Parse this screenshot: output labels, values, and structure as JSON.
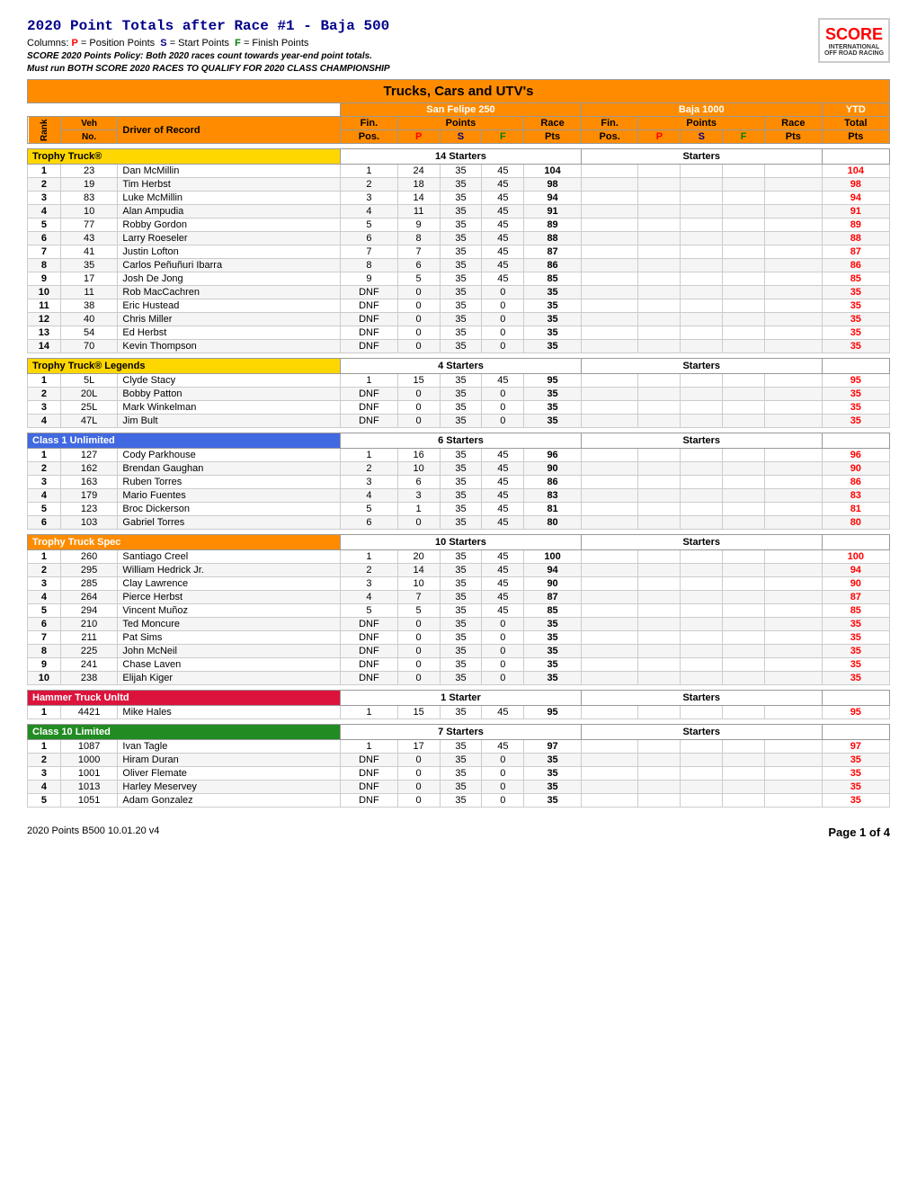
{
  "page": {
    "title": "2020 Point Totals after Race #1 - Baja 500",
    "subtitle": "Columns: P = Position Points  S = Start Points  F = Finish Points",
    "policy1": "SCORE 2020 Points Policy: Both 2020 races count towards year-end point totals.",
    "policy2": "Must run BOTH SCORE 2020 RACES TO QUALIFY FOR 2020 CLASS CHAMPIONSHIP",
    "main_section": "Trucks, Cars and UTV's",
    "sf_label": "San Felipe 250",
    "baja_label": "Baja 1000",
    "ytd_label": "YTD",
    "col_fin": "Fin.",
    "col_points": "Points",
    "col_race": "Race",
    "col_pos": "Pos.",
    "col_p": "P",
    "col_s": "S",
    "col_f": "F",
    "col_pts": "Pts",
    "col_total": "Total",
    "col_rank": "Rank",
    "col_veh": "Veh",
    "col_veh_no": "No.",
    "col_driver": "Driver of Record"
  },
  "classes": [
    {
      "name": "Trophy Truck®",
      "color": "yellow",
      "starters": "14 Starters",
      "baja_starters": "Starters",
      "drivers": [
        {
          "rank": "1",
          "veh": "23",
          "driver": "Dan McMillin",
          "fin": "1",
          "p": "24",
          "s": "35",
          "f": "45",
          "pts": "104",
          "bfin": "",
          "bp": "",
          "bs": "",
          "bf": "",
          "bpts": "",
          "ytd": "104"
        },
        {
          "rank": "2",
          "veh": "19",
          "driver": "Tim Herbst",
          "fin": "2",
          "p": "18",
          "s": "35",
          "f": "45",
          "pts": "98",
          "bfin": "",
          "bp": "",
          "bs": "",
          "bf": "",
          "bpts": "",
          "ytd": "98"
        },
        {
          "rank": "3",
          "veh": "83",
          "driver": "Luke McMillin",
          "fin": "3",
          "p": "14",
          "s": "35",
          "f": "45",
          "pts": "94",
          "bfin": "",
          "bp": "",
          "bs": "",
          "bf": "",
          "bpts": "",
          "ytd": "94"
        },
        {
          "rank": "4",
          "veh": "10",
          "driver": "Alan Ampudia",
          "fin": "4",
          "p": "11",
          "s": "35",
          "f": "45",
          "pts": "91",
          "bfin": "",
          "bp": "",
          "bs": "",
          "bf": "",
          "bpts": "",
          "ytd": "91"
        },
        {
          "rank": "5",
          "veh": "77",
          "driver": "Robby Gordon",
          "fin": "5",
          "p": "9",
          "s": "35",
          "f": "45",
          "pts": "89",
          "bfin": "",
          "bp": "",
          "bs": "",
          "bf": "",
          "bpts": "",
          "ytd": "89"
        },
        {
          "rank": "6",
          "veh": "43",
          "driver": "Larry Roeseler",
          "fin": "6",
          "p": "8",
          "s": "35",
          "f": "45",
          "pts": "88",
          "bfin": "",
          "bp": "",
          "bs": "",
          "bf": "",
          "bpts": "",
          "ytd": "88"
        },
        {
          "rank": "7",
          "veh": "41",
          "driver": "Justin Lofton",
          "fin": "7",
          "p": "7",
          "s": "35",
          "f": "45",
          "pts": "87",
          "bfin": "",
          "bp": "",
          "bs": "",
          "bf": "",
          "bpts": "",
          "ytd": "87"
        },
        {
          "rank": "8",
          "veh": "35",
          "driver": "Carlos Peñuñuri Ibarra",
          "fin": "8",
          "p": "6",
          "s": "35",
          "f": "45",
          "pts": "86",
          "bfin": "",
          "bp": "",
          "bs": "",
          "bf": "",
          "bpts": "",
          "ytd": "86"
        },
        {
          "rank": "9",
          "veh": "17",
          "driver": "Josh De Jong",
          "fin": "9",
          "p": "5",
          "s": "35",
          "f": "45",
          "pts": "85",
          "bfin": "",
          "bp": "",
          "bs": "",
          "bf": "",
          "bpts": "",
          "ytd": "85"
        },
        {
          "rank": "10",
          "veh": "11",
          "driver": "Rob MacCachren",
          "fin": "DNF",
          "p": "0",
          "s": "35",
          "f": "0",
          "pts": "35",
          "bfin": "",
          "bp": "",
          "bs": "",
          "bf": "",
          "bpts": "",
          "ytd": "35"
        },
        {
          "rank": "11",
          "veh": "38",
          "driver": "Eric Hustead",
          "fin": "DNF",
          "p": "0",
          "s": "35",
          "f": "0",
          "pts": "35",
          "bfin": "",
          "bp": "",
          "bs": "",
          "bf": "",
          "bpts": "",
          "ytd": "35"
        },
        {
          "rank": "12",
          "veh": "40",
          "driver": "Chris Miller",
          "fin": "DNF",
          "p": "0",
          "s": "35",
          "f": "0",
          "pts": "35",
          "bfin": "",
          "bp": "",
          "bs": "",
          "bf": "",
          "bpts": "",
          "ytd": "35"
        },
        {
          "rank": "13",
          "veh": "54",
          "driver": "Ed Herbst",
          "fin": "DNF",
          "p": "0",
          "s": "35",
          "f": "0",
          "pts": "35",
          "bfin": "",
          "bp": "",
          "bs": "",
          "bf": "",
          "bpts": "",
          "ytd": "35"
        },
        {
          "rank": "14",
          "veh": "70",
          "driver": "Kevin Thompson",
          "fin": "DNF",
          "p": "0",
          "s": "35",
          "f": "0",
          "pts": "35",
          "bfin": "",
          "bp": "",
          "bs": "",
          "bf": "",
          "bpts": "",
          "ytd": "35"
        }
      ]
    },
    {
      "name": "Trophy Truck® Legends",
      "color": "yellow",
      "starters": "4 Starters",
      "baja_starters": "Starters",
      "drivers": [
        {
          "rank": "1",
          "veh": "5L",
          "driver": "Clyde Stacy",
          "fin": "1",
          "p": "15",
          "s": "35",
          "f": "45",
          "pts": "95",
          "bfin": "",
          "bp": "",
          "bs": "",
          "bf": "",
          "bpts": "",
          "ytd": "95"
        },
        {
          "rank": "2",
          "veh": "20L",
          "driver": "Bobby Patton",
          "fin": "DNF",
          "p": "0",
          "s": "35",
          "f": "0",
          "pts": "35",
          "bfin": "",
          "bp": "",
          "bs": "",
          "bf": "",
          "bpts": "",
          "ytd": "35"
        },
        {
          "rank": "3",
          "veh": "25L",
          "driver": "Mark Winkelman",
          "fin": "DNF",
          "p": "0",
          "s": "35",
          "f": "0",
          "pts": "35",
          "bfin": "",
          "bp": "",
          "bs": "",
          "bf": "",
          "bpts": "",
          "ytd": "35"
        },
        {
          "rank": "4",
          "veh": "47L",
          "driver": "Jim Bult",
          "fin": "DNF",
          "p": "0",
          "s": "35",
          "f": "0",
          "pts": "35",
          "bfin": "",
          "bp": "",
          "bs": "",
          "bf": "",
          "bpts": "",
          "ytd": "35"
        }
      ]
    },
    {
      "name": "Class 1 Unlimited",
      "color": "blue",
      "starters": "6 Starters",
      "baja_starters": "Starters",
      "drivers": [
        {
          "rank": "1",
          "veh": "127",
          "driver": "Cody Parkhouse",
          "fin": "1",
          "p": "16",
          "s": "35",
          "f": "45",
          "pts": "96",
          "bfin": "",
          "bp": "",
          "bs": "",
          "bf": "",
          "bpts": "",
          "ytd": "96"
        },
        {
          "rank": "2",
          "veh": "162",
          "driver": "Brendan Gaughan",
          "fin": "2",
          "p": "10",
          "s": "35",
          "f": "45",
          "pts": "90",
          "bfin": "",
          "bp": "",
          "bs": "",
          "bf": "",
          "bpts": "",
          "ytd": "90"
        },
        {
          "rank": "3",
          "veh": "163",
          "driver": "Ruben Torres",
          "fin": "3",
          "p": "6",
          "s": "35",
          "f": "45",
          "pts": "86",
          "bfin": "",
          "bp": "",
          "bs": "",
          "bf": "",
          "bpts": "",
          "ytd": "86"
        },
        {
          "rank": "4",
          "veh": "179",
          "driver": "Mario Fuentes",
          "fin": "4",
          "p": "3",
          "s": "35",
          "f": "45",
          "pts": "83",
          "bfin": "",
          "bp": "",
          "bs": "",
          "bf": "",
          "bpts": "",
          "ytd": "83"
        },
        {
          "rank": "5",
          "veh": "123",
          "driver": "Broc Dickerson",
          "fin": "5",
          "p": "1",
          "s": "35",
          "f": "45",
          "pts": "81",
          "bfin": "",
          "bp": "",
          "bs": "",
          "bf": "",
          "bpts": "",
          "ytd": "81"
        },
        {
          "rank": "6",
          "veh": "103",
          "driver": "Gabriel Torres",
          "fin": "6",
          "p": "0",
          "s": "35",
          "f": "45",
          "pts": "80",
          "bfin": "",
          "bp": "",
          "bs": "",
          "bf": "",
          "bpts": "",
          "ytd": "80"
        }
      ]
    },
    {
      "name": "Trophy Truck Spec",
      "color": "orange",
      "starters": "10 Starters",
      "baja_starters": "Starters",
      "drivers": [
        {
          "rank": "1",
          "veh": "260",
          "driver": "Santiago Creel",
          "fin": "1",
          "p": "20",
          "s": "35",
          "f": "45",
          "pts": "100",
          "bfin": "",
          "bp": "",
          "bs": "",
          "bf": "",
          "bpts": "",
          "ytd": "100"
        },
        {
          "rank": "2",
          "veh": "295",
          "driver": "William Hedrick Jr.",
          "fin": "2",
          "p": "14",
          "s": "35",
          "f": "45",
          "pts": "94",
          "bfin": "",
          "bp": "",
          "bs": "",
          "bf": "",
          "bpts": "",
          "ytd": "94"
        },
        {
          "rank": "3",
          "veh": "285",
          "driver": "Clay Lawrence",
          "fin": "3",
          "p": "10",
          "s": "35",
          "f": "45",
          "pts": "90",
          "bfin": "",
          "bp": "",
          "bs": "",
          "bf": "",
          "bpts": "",
          "ytd": "90"
        },
        {
          "rank": "4",
          "veh": "264",
          "driver": "Pierce Herbst",
          "fin": "4",
          "p": "7",
          "s": "35",
          "f": "45",
          "pts": "87",
          "bfin": "",
          "bp": "",
          "bs": "",
          "bf": "",
          "bpts": "",
          "ytd": "87"
        },
        {
          "rank": "5",
          "veh": "294",
          "driver": "Vincent Muñoz",
          "fin": "5",
          "p": "5",
          "s": "35",
          "f": "45",
          "pts": "85",
          "bfin": "",
          "bp": "",
          "bs": "",
          "bf": "",
          "bpts": "",
          "ytd": "85"
        },
        {
          "rank": "6",
          "veh": "210",
          "driver": "Ted Moncure",
          "fin": "DNF",
          "p": "0",
          "s": "35",
          "f": "0",
          "pts": "35",
          "bfin": "",
          "bp": "",
          "bs": "",
          "bf": "",
          "bpts": "",
          "ytd": "35"
        },
        {
          "rank": "7",
          "veh": "211",
          "driver": "Pat Sims",
          "fin": "DNF",
          "p": "0",
          "s": "35",
          "f": "0",
          "pts": "35",
          "bfin": "",
          "bp": "",
          "bs": "",
          "bf": "",
          "bpts": "",
          "ytd": "35"
        },
        {
          "rank": "8",
          "veh": "225",
          "driver": "John McNeil",
          "fin": "DNF",
          "p": "0",
          "s": "35",
          "f": "0",
          "pts": "35",
          "bfin": "",
          "bp": "",
          "bs": "",
          "bf": "",
          "bpts": "",
          "ytd": "35"
        },
        {
          "rank": "9",
          "veh": "241",
          "driver": "Chase Laven",
          "fin": "DNF",
          "p": "0",
          "s": "35",
          "f": "0",
          "pts": "35",
          "bfin": "",
          "bp": "",
          "bs": "",
          "bf": "",
          "bpts": "",
          "ytd": "35"
        },
        {
          "rank": "10",
          "veh": "238",
          "driver": "Elijah Kiger",
          "fin": "DNF",
          "p": "0",
          "s": "35",
          "f": "0",
          "pts": "35",
          "bfin": "",
          "bp": "",
          "bs": "",
          "bf": "",
          "bpts": "",
          "ytd": "35"
        }
      ]
    },
    {
      "name": "Hammer Truck Unltd",
      "color": "red",
      "starters": "1 Starter",
      "baja_starters": "Starters",
      "drivers": [
        {
          "rank": "1",
          "veh": "4421",
          "driver": "Mike Hales",
          "fin": "1",
          "p": "15",
          "s": "35",
          "f": "45",
          "pts": "95",
          "bfin": "",
          "bp": "",
          "bs": "",
          "bf": "",
          "bpts": "",
          "ytd": "95"
        }
      ]
    },
    {
      "name": "Class 10 Limited",
      "color": "green",
      "starters": "7 Starters",
      "baja_starters": "Starters",
      "drivers": [
        {
          "rank": "1",
          "veh": "1087",
          "driver": "Ivan Tagle",
          "fin": "1",
          "p": "17",
          "s": "35",
          "f": "45",
          "pts": "97",
          "bfin": "",
          "bp": "",
          "bs": "",
          "bf": "",
          "bpts": "",
          "ytd": "97"
        },
        {
          "rank": "2",
          "veh": "1000",
          "driver": "Hiram Duran",
          "fin": "DNF",
          "p": "0",
          "s": "35",
          "f": "0",
          "pts": "35",
          "bfin": "",
          "bp": "",
          "bs": "",
          "bf": "",
          "bpts": "",
          "ytd": "35"
        },
        {
          "rank": "3",
          "veh": "1001",
          "driver": "Oliver Flemate",
          "fin": "DNF",
          "p": "0",
          "s": "35",
          "f": "0",
          "pts": "35",
          "bfin": "",
          "bp": "",
          "bs": "",
          "bf": "",
          "bpts": "",
          "ytd": "35"
        },
        {
          "rank": "4",
          "veh": "1013",
          "driver": "Harley Meservey",
          "fin": "DNF",
          "p": "0",
          "s": "35",
          "f": "0",
          "pts": "35",
          "bfin": "",
          "bp": "",
          "bs": "",
          "bf": "",
          "bpts": "",
          "ytd": "35"
        },
        {
          "rank": "5",
          "veh": "1051",
          "driver": "Adam Gonzalez",
          "fin": "DNF",
          "p": "0",
          "s": "35",
          "f": "0",
          "pts": "35",
          "bfin": "",
          "bp": "",
          "bs": "",
          "bf": "",
          "bpts": "",
          "ytd": "35"
        }
      ]
    }
  ],
  "footer": {
    "left": "2020 Points B500 10.01.20 v4",
    "right": "Page 1 of 4"
  }
}
